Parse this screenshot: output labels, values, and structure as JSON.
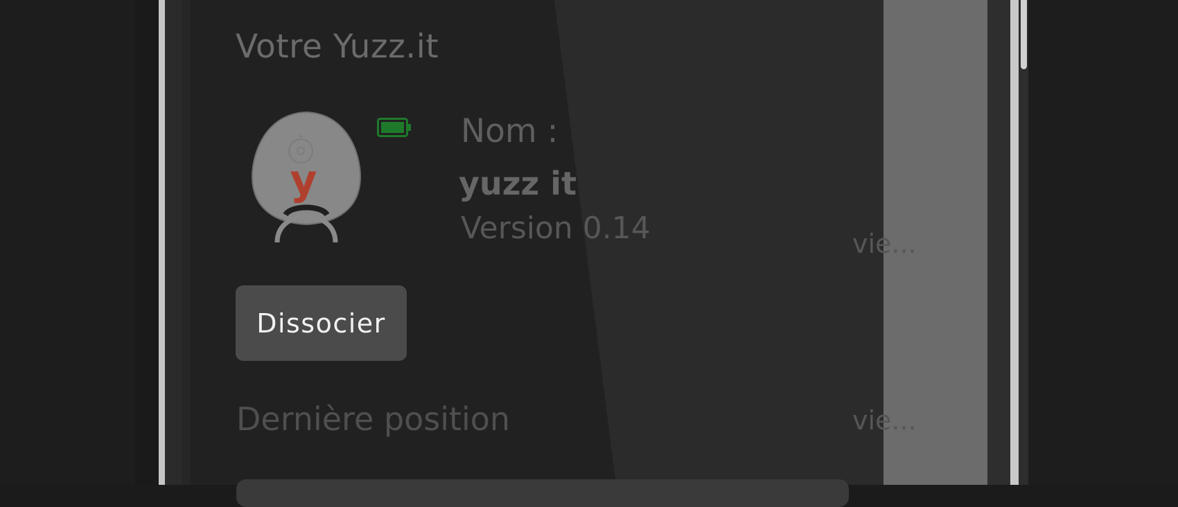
{
  "panel": {
    "section_title": "Votre Yuzz.it",
    "device": {
      "image_icon": "yuzz-it-tracker-icon",
      "logo_letter": "y",
      "battery_icon": "battery-full-icon",
      "battery_color": "#1e7a2a",
      "name_label": "Nom :",
      "name_value": "yuzz it",
      "version": "Version 0.14",
      "overflow_text": "vie..."
    },
    "dissociate_button_label": "Dissocier",
    "last_position_title": "Dernière position",
    "last_position_overflow": "vie..."
  },
  "colors": {
    "panel_bg": "#212121",
    "button_bg": "#4b4b4b",
    "logo_red": "#b0402e"
  }
}
